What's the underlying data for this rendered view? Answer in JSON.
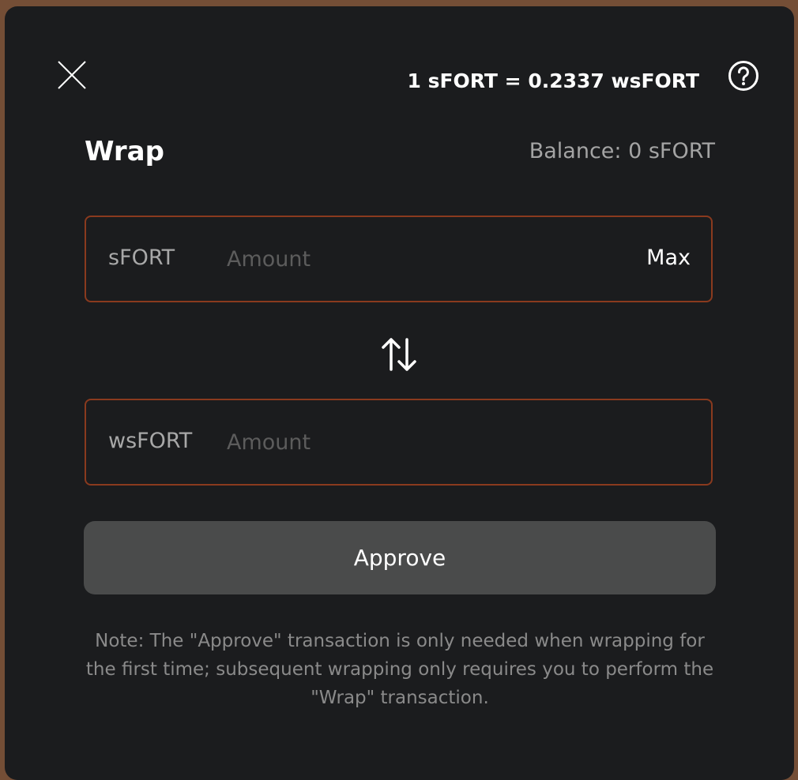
{
  "header": {
    "rate": "1 sFORT = 0.2337 wsFORT"
  },
  "title": "Wrap",
  "balance": "Balance: 0 sFORT",
  "from": {
    "token": "sFORT",
    "placeholder": "Amount",
    "value": "",
    "max_label": "Max"
  },
  "to": {
    "token": "wsFORT",
    "placeholder": "Amount",
    "value": ""
  },
  "approve_label": "Approve",
  "note": "Note: The \"Approve\" transaction is only needed when wrapping for the first time; subsequent wrapping only requires you to perform the \"Wrap\" transaction.",
  "colors": {
    "accent_border": "#8a3a1e",
    "background": "#1b1c1e",
    "button": "#4a4b4b"
  }
}
